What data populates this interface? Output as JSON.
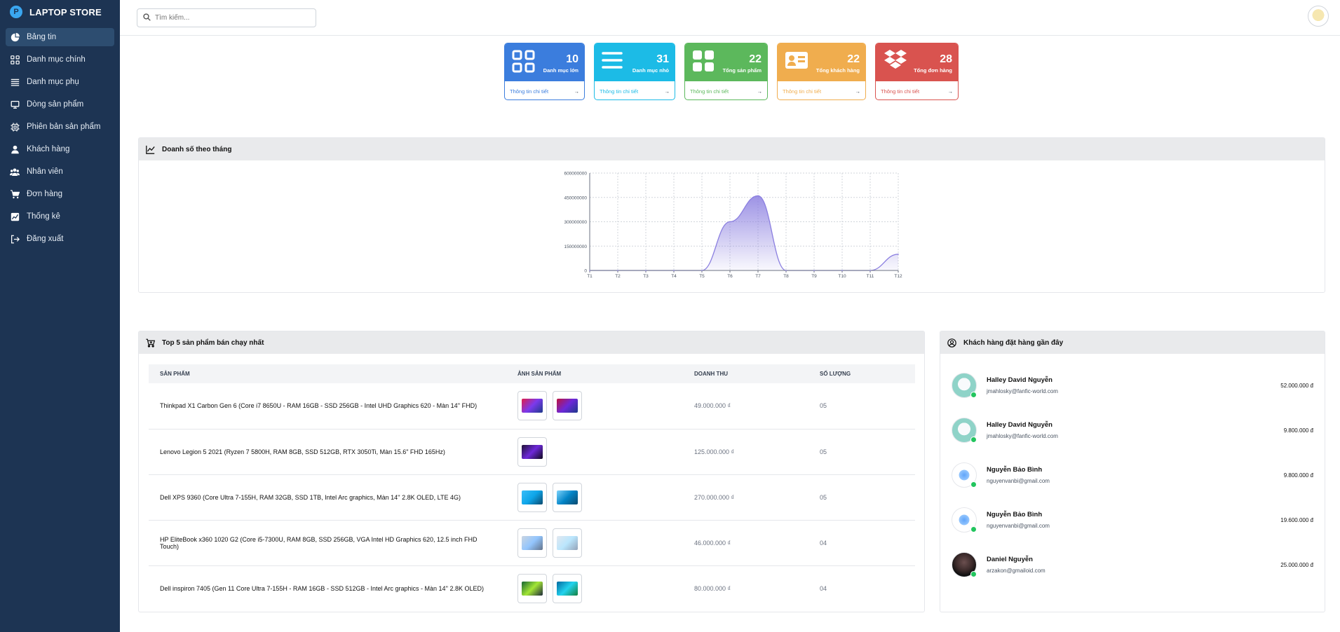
{
  "brand": {
    "name": "LAPTOP STORE"
  },
  "sidebar": {
    "items": [
      {
        "label": "Bảng tin",
        "icon": "pie-chart-icon",
        "active": true
      },
      {
        "label": "Danh mục chính",
        "icon": "grid-icon"
      },
      {
        "label": "Danh mục phụ",
        "icon": "list-icon"
      },
      {
        "label": "Dòng sản phẩm",
        "icon": "monitor-icon"
      },
      {
        "label": "Phiên bản sản phẩm",
        "icon": "chip-icon"
      },
      {
        "label": "Khách hàng",
        "icon": "user-icon"
      },
      {
        "label": "Nhân viên",
        "icon": "users-icon"
      },
      {
        "label": "Đơn hàng",
        "icon": "cart-icon"
      },
      {
        "label": "Thống kê",
        "icon": "stats-icon"
      },
      {
        "label": "Đăng xuất",
        "icon": "logout-icon"
      }
    ]
  },
  "search": {
    "placeholder": "Tìm kiếm..."
  },
  "cards": [
    {
      "value": "10",
      "label": "Danh mục lớn",
      "link": "Thông tin chi tiết",
      "color": "#3b7ddd",
      "icon": "grid-icon"
    },
    {
      "value": "31",
      "label": "Danh mục nhỏ",
      "link": "Thông tin chi tiết",
      "color": "#1cbbe6",
      "icon": "list-icon"
    },
    {
      "value": "22",
      "label": "Tổng sản phẩm",
      "link": "Thông tin chi tiết",
      "color": "#5cb85c",
      "icon": "tiles-icon"
    },
    {
      "value": "22",
      "label": "Tổng khách hàng",
      "link": "Thông tin chi tiết",
      "color": "#f0ad4e",
      "icon": "id-card-icon"
    },
    {
      "value": "28",
      "label": "Tổng đơn hàng",
      "link": "Thông tin chi tiết",
      "color": "#d9534f",
      "icon": "dropbox-icon"
    }
  ],
  "sales": {
    "title": "Doanh số theo tháng"
  },
  "chart_data": {
    "type": "area",
    "categories": [
      "T1",
      "T2",
      "T3",
      "T4",
      "T5",
      "T6",
      "T7",
      "T8",
      "T9",
      "T10",
      "T11",
      "T12"
    ],
    "values": [
      0,
      0,
      0,
      0,
      0,
      300000000,
      460000000,
      0,
      0,
      0,
      0,
      100000000
    ],
    "ylim": [
      0,
      600000000
    ],
    "yticks": [
      "0",
      "150000000",
      "300000000",
      "450000000",
      "600000000"
    ],
    "grid": true,
    "color": "#8b7fe0"
  },
  "top": {
    "title": "Top 5 sản phẩm bán chạy nhất",
    "headers": {
      "product": "SẢN PHẨM",
      "image": "ẢNH SẢN PHẨM",
      "revenue": "DOANH THU",
      "qty": "SỐ LƯỢNG"
    },
    "rows": [
      {
        "name": "Thinkpad X1 Carbon Gen 6 (Core i7 8650U - RAM 16GB - SSD 256GB - Intel UHD Graphics 620 - Màn 14'' FHD)",
        "revenue": "49.000.000 ₫",
        "qty": "05"
      },
      {
        "name": "Lenovo Legion 5 2021 (Ryzen 7 5800H, RAM 8GB, SSD 512GB, RTX 3050Ti, Màn 15.6\" FHD 165Hz)",
        "revenue": "125.000.000 ₫",
        "qty": "05"
      },
      {
        "name": "Dell XPS 9360 (Core Ultra 7-155H, RAM 32GB, SSD 1TB, Intel Arc graphics, Màn 14'' 2.8K OLED, LTE 4G)",
        "revenue": "270.000.000 ₫",
        "qty": "05"
      },
      {
        "name": "HP EliteBook x360 1020 G2 (Core i5-7300U, RAM 8GB, SSD 256GB, VGA Intel HD Graphics 620, 12.5 inch FHD Touch)",
        "revenue": "46.000.000 ₫",
        "qty": "04"
      },
      {
        "name": "Dell inspiron 7405 (Gen 11 Core Ultra 7-155H - RAM 16GB - SSD 512GB - Intel Arc graphics - Màn 14'' 2.8K OLED)",
        "revenue": "80.000.000 ₫",
        "qty": "04"
      }
    ]
  },
  "recent": {
    "title": "Khách hàng đặt hàng gần đây",
    "customers": [
      {
        "name": "Halley David Nguyễn",
        "email": "jmahlosky@fanfic-world.com",
        "amount": "52.000.000 đ"
      },
      {
        "name": "Halley David Nguyễn",
        "email": "jmahlosky@fanfic-world.com",
        "amount": "9.800.000 đ"
      },
      {
        "name": "Nguyễn Bảo Bình",
        "email": "nguyenvanbi@gmail.com",
        "amount": "9.800.000 đ"
      },
      {
        "name": "Nguyễn Bảo Bình",
        "email": "nguyenvanbi@gmail.com",
        "amount": "19.600.000 đ"
      },
      {
        "name": "Daniel Nguyễn",
        "email": "arzakon@gmailoid.com",
        "amount": "25.000.000 đ"
      }
    ]
  }
}
